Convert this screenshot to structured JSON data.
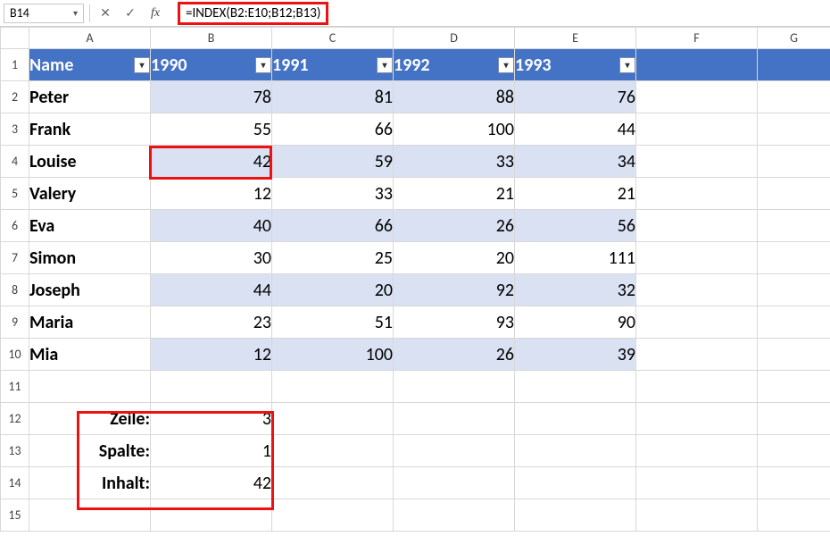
{
  "name_box": "B14",
  "formula": "=INDEX(B2:E10;B12;B13)",
  "columns": [
    "A",
    "B",
    "C",
    "D",
    "E",
    "F",
    "G"
  ],
  "row_numbers": [
    "1",
    "2",
    "3",
    "4",
    "5",
    "6",
    "7",
    "8",
    "9",
    "10",
    "11",
    "12",
    "13",
    "14",
    "15"
  ],
  "header": {
    "name_label": "Name",
    "years": [
      "1990",
      "1991",
      "1992",
      "1993"
    ]
  },
  "rows": [
    {
      "name": "Peter",
      "vals": [
        "78",
        "81",
        "88",
        "76"
      ]
    },
    {
      "name": "Frank",
      "vals": [
        "55",
        "66",
        "100",
        "44"
      ]
    },
    {
      "name": "Louise",
      "vals": [
        "42",
        "59",
        "33",
        "34"
      ]
    },
    {
      "name": "Valery",
      "vals": [
        "12",
        "33",
        "21",
        "21"
      ]
    },
    {
      "name": "Eva",
      "vals": [
        "40",
        "66",
        "26",
        "56"
      ]
    },
    {
      "name": "Simon",
      "vals": [
        "30",
        "25",
        "20",
        "111"
      ]
    },
    {
      "name": "Joseph",
      "vals": [
        "44",
        "20",
        "92",
        "32"
      ]
    },
    {
      "name": "Maria",
      "vals": [
        "23",
        "51",
        "93",
        "90"
      ]
    },
    {
      "name": "Mia",
      "vals": [
        "12",
        "100",
        "26",
        "39"
      ]
    }
  ],
  "lookup": {
    "zeile_label": "Zeile:",
    "zeile_value": "3",
    "spalte_label": "Spalte:",
    "spalte_value": "1",
    "inhalt_label": "Inhalt:",
    "inhalt_value": "42"
  },
  "icons": {
    "dropdown": "▾",
    "cancel": "✕",
    "confirm": "✓",
    "fx": "fx"
  },
  "chart_data": {
    "type": "table",
    "title": "",
    "columns": [
      "Name",
      "1990",
      "1991",
      "1992",
      "1993"
    ],
    "rows": [
      [
        "Peter",
        78,
        81,
        88,
        76
      ],
      [
        "Frank",
        55,
        66,
        100,
        44
      ],
      [
        "Louise",
        42,
        59,
        33,
        34
      ],
      [
        "Valery",
        12,
        33,
        21,
        21
      ],
      [
        "Eva",
        40,
        66,
        26,
        56
      ],
      [
        "Simon",
        30,
        25,
        20,
        111
      ],
      [
        "Joseph",
        44,
        20,
        92,
        32
      ],
      [
        "Maria",
        23,
        51,
        93,
        90
      ],
      [
        "Mia",
        12,
        100,
        26,
        39
      ]
    ],
    "lookup": {
      "Zeile": 3,
      "Spalte": 1,
      "Inhalt": 42
    },
    "formula": "=INDEX(B2:E10;B12;B13)"
  }
}
